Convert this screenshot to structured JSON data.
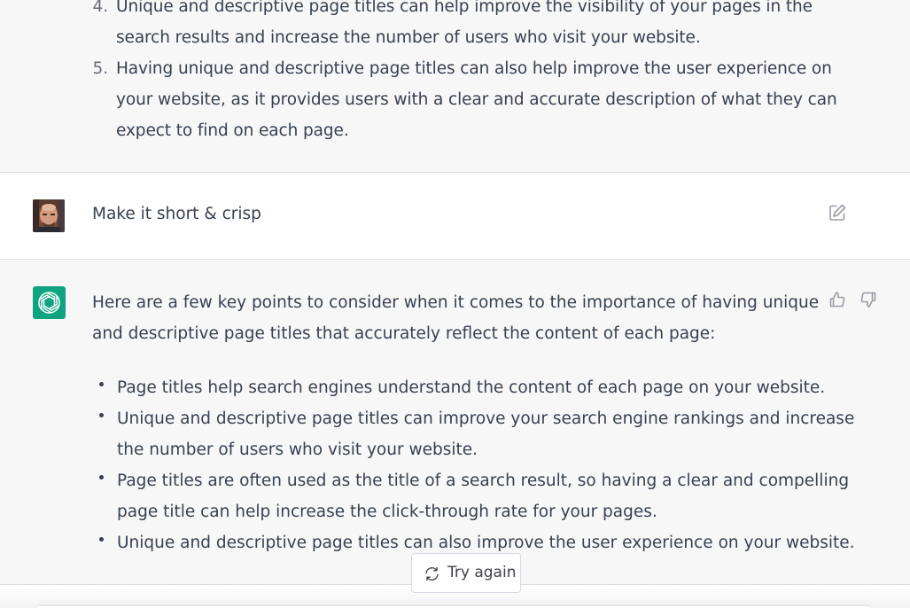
{
  "previous_answer": {
    "items": [
      {
        "num": "4.",
        "lines": [
          "Unique and descriptive page titles can help improve the visibility of your pages in the",
          "search results and increase the number of users who visit your website."
        ]
      },
      {
        "num": "5.",
        "lines": [
          "Having unique and descriptive page titles can also help improve the user experience on",
          "your website, as it provides users with a clear and accurate description of what they can",
          "expect to find on each page."
        ]
      }
    ]
  },
  "user_message": {
    "text": "Make it short & crisp",
    "edit_icon": "edit-icon"
  },
  "assistant_message": {
    "intro_lines": [
      "Here are a few key points to consider when it comes to the importance of having unique",
      "and descriptive page titles that accurately reflect the content of each page:"
    ],
    "bullets": [
      {
        "lines": [
          "Page titles help search engines understand the content of each page on your website."
        ]
      },
      {
        "lines": [
          "Unique and descriptive page titles can improve your search engine rankings and increase",
          "the number of users who visit your website."
        ]
      },
      {
        "lines": [
          "Page titles are often used as the title of a search result, so having a clear and compelling",
          "page title can help increase the click-through rate for your pages."
        ]
      },
      {
        "lines": [
          "Unique and descriptive page titles can also improve the user experience on your website."
        ]
      }
    ],
    "feedback_icons": [
      "thumbs-up-icon",
      "thumbs-down-icon"
    ]
  },
  "try_again": {
    "label": "Try again",
    "icon": "refresh-icon"
  },
  "colors": {
    "assistant_bg": "#f7f7f8",
    "user_bg": "#ffffff",
    "brand_green": "#10a37f",
    "text": "#374151"
  }
}
